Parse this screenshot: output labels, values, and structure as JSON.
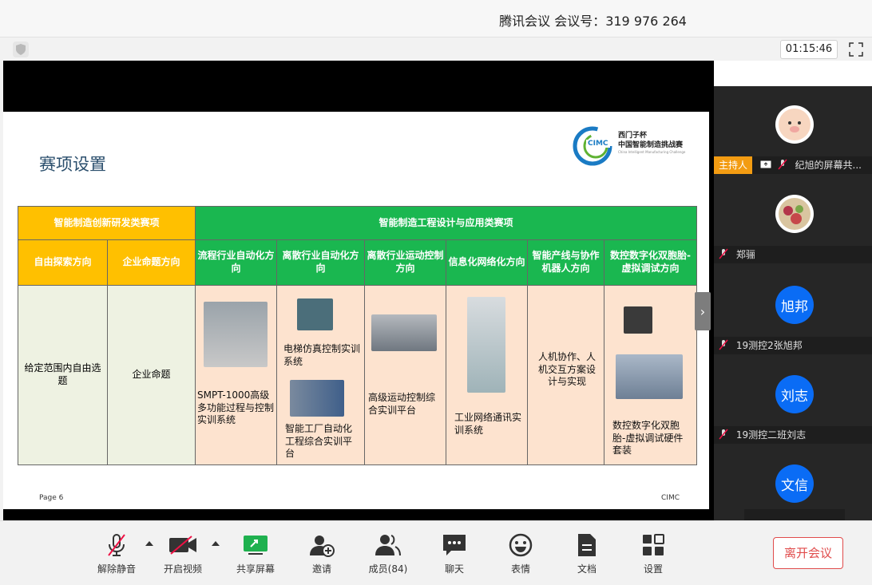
{
  "title_bar": {
    "meeting_title": "腾讯会议 会议号：319 976 264"
  },
  "info_bar": {
    "timer": "01:15:46",
    "shield_icon": "shield-icon",
    "fullscreen_icon": "fullscreen-icon"
  },
  "slide": {
    "title": "赛项设置",
    "logo": {
      "line1": "西门子杯",
      "line2": "中国智能制造挑战赛",
      "line3": "China Intelligent Manufacturing Challenge",
      "badge": "CIMC"
    },
    "page": "Page 6",
    "footer": "CIMC",
    "table": {
      "group1": "智能制造创新研发类赛项",
      "group2": "智能制造工程设计与应用类赛项",
      "columns": [
        "自由探索方向",
        "企业命题方向",
        "流程行业自动化方向",
        "离散行业自动化方向",
        "离散行业运动控制方向",
        "信息化网络化方向",
        "智能产线与协作机器人方向",
        "数控数字化双胞胎-虚拟调试方向"
      ],
      "cells": {
        "c1": "给定范围内自由选题",
        "c2": "企业命题",
        "c3": "SMPT-1000高级多功能过程与控制实训系统",
        "c4a": "电梯仿真控制实训系统",
        "c4b": "智能工厂自动化工程综合实训平台",
        "c5": "高级运动控制综合实训平台",
        "c6": "工业网络通讯实训系统",
        "c7": "人机协作、人机交互方案设计与实现",
        "c8": "数控数字化双胞胎-虚拟调试硬件套装"
      }
    }
  },
  "participants": [
    {
      "avatar": "pig-avatar",
      "host_label": "主持人",
      "name": "纪旭的屏幕共...",
      "color": "#ffffff"
    },
    {
      "avatar": "food-avatar",
      "name": "郑骊",
      "color": "#ffffff"
    },
    {
      "avatar_text": "旭邦",
      "name": "19测控2张旭邦",
      "color": "#0a6cf5"
    },
    {
      "avatar_text": "刘志",
      "name": "19测控二班刘志",
      "color": "#0a6cf5"
    },
    {
      "avatar_text": "文信",
      "color": "#0a6cf5"
    }
  ],
  "toolbar": {
    "unmute": "解除静音",
    "video": "开启视频",
    "share": "共享屏幕",
    "invite": "邀请",
    "members": "成员(84)",
    "chat": "聊天",
    "emoji": "表情",
    "docs": "文档",
    "settings": "设置",
    "leave": "离开会议"
  }
}
